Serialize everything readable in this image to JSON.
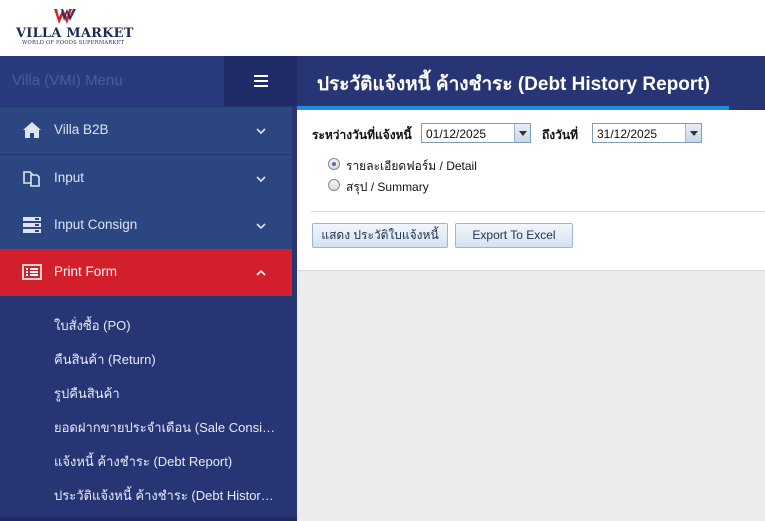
{
  "brand": {
    "name": "VILLA MARKET",
    "tagline": "WORLD OF FOODS SUPERMARKET",
    "colors": {
      "navy": "#273574",
      "red": "#d31f2b",
      "accent": "#1e8fe0"
    }
  },
  "sidebar": {
    "menu_title": "Villa (VMI) Menu",
    "toggle_icon": "hamburger-icon",
    "items": [
      {
        "label": "Villa B2B",
        "icon": "home-icon",
        "expanded": false
      },
      {
        "label": "Input",
        "icon": "copy-icon",
        "expanded": false
      },
      {
        "label": "Input Consign",
        "icon": "server-icon",
        "expanded": false
      },
      {
        "label": "Print Form",
        "icon": "list-icon",
        "expanded": true,
        "active": true
      }
    ],
    "sub_items": [
      {
        "label": "ใบสั่งซื้อ (PO)"
      },
      {
        "label": "คืนสินค้า (Return)"
      },
      {
        "label": "รูปคืนสินค้า"
      },
      {
        "label": "ยอดฝากขายประจำเดือน (Sale Consign)"
      },
      {
        "label": "แจ้งหนี้ ค้างชำระ (Debt Report)"
      },
      {
        "label": "ประวัติแจ้งหนี้ ค้างชำระ (Debt History ..."
      }
    ]
  },
  "main": {
    "title": "ประวัติแจ้งหนี้ ค้างชำระ (Debt History Report)",
    "form": {
      "from_label": "ระหว่างวันที่แจ้งหนี้",
      "from_value": "01/12/2025",
      "to_label": "ถึงวันที่",
      "to_value": "31/12/2025",
      "options": [
        {
          "label": "รายละเอียดฟอร์ม / Detail",
          "selected": true
        },
        {
          "label": "สรุป / Summary",
          "selected": false
        }
      ],
      "show_button": "แสดง ประวัติใบแจ้งหนี้",
      "export_button": "Export To Excel"
    }
  }
}
